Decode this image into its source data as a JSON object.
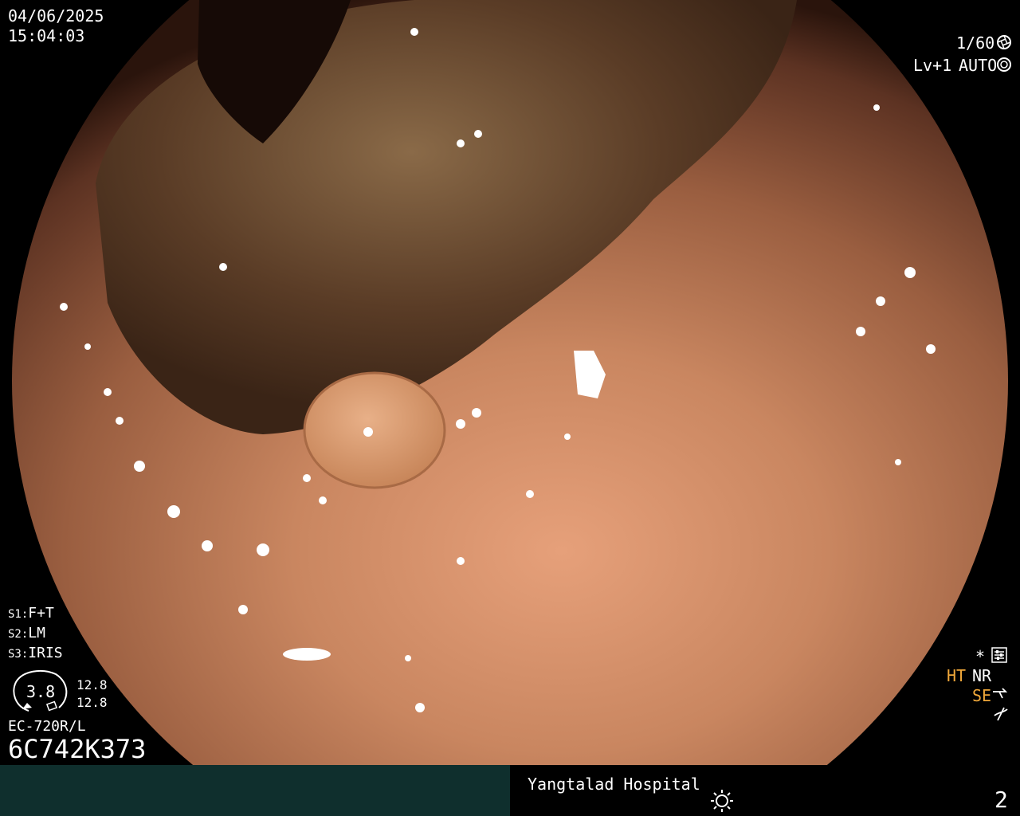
{
  "header": {
    "date": "04/06/2025",
    "time": "15:04:03",
    "shutter": "1/60",
    "level": "Lv+1",
    "mode": "AUTO"
  },
  "scope_settings": {
    "s1_key": "S1:",
    "s1_val": "F+T",
    "s2_key": "S2:",
    "s2_val": "LM",
    "s3_key": "S3:",
    "s3_val": "IRIS",
    "dial_value": "3.8",
    "readout_top": "12.8",
    "readout_bottom": "12.8",
    "scope_model": "EC-720R/L",
    "serial": "6C742K373"
  },
  "enhancement": {
    "star": "*",
    "ht": "HT",
    "nr": "NR",
    "se": "SE",
    "icons": [
      "settings-icon",
      "pump-icon",
      "freeze-icon"
    ]
  },
  "footer": {
    "hospital": "Yangtalad Hospital",
    "page_number": "2",
    "icon": "brightness-icon"
  },
  "colors": {
    "footer_left": "#0f2f2d",
    "accent_orange": "#f0a83a",
    "mucosa": "#c07a55"
  }
}
